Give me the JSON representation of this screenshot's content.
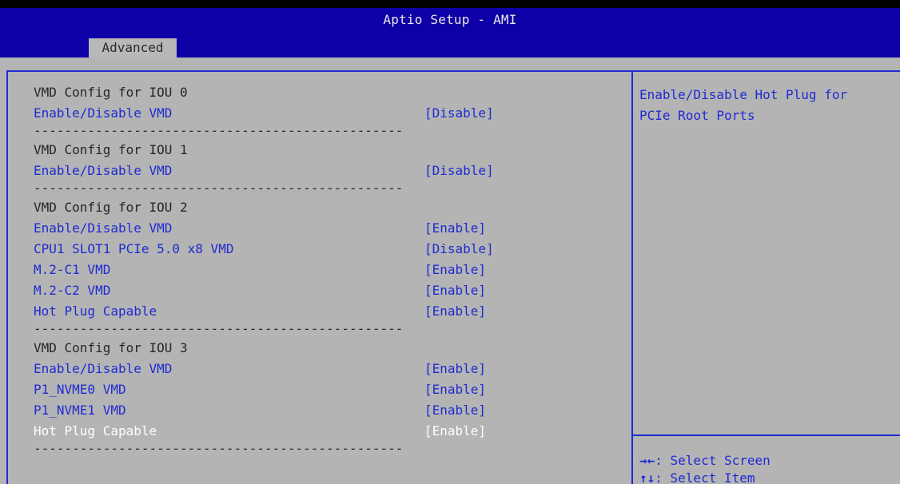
{
  "header": {
    "title": "Aptio Setup - AMI",
    "tab": "Advanced"
  },
  "separator": "------------------------------------------------",
  "sections": [
    {
      "heading": "VMD Config for IOU 0",
      "items": [
        {
          "label": "Enable/Disable VMD",
          "value": "[Disable]"
        }
      ]
    },
    {
      "heading": "VMD Config for IOU 1",
      "items": [
        {
          "label": "Enable/Disable VMD",
          "value": "[Disable]"
        }
      ]
    },
    {
      "heading": "VMD Config for IOU 2",
      "items": [
        {
          "label": "Enable/Disable VMD",
          "value": "[Enable]"
        },
        {
          "label": "CPU1 SLOT1 PCIe 5.0 x8 VMD",
          "value": "[Disable]"
        },
        {
          "label": "M.2-C1 VMD",
          "value": "[Enable]"
        },
        {
          "label": "M.2-C2 VMD",
          "value": "[Enable]"
        },
        {
          "label": "Hot Plug Capable",
          "value": "[Enable]"
        }
      ]
    },
    {
      "heading": "VMD Config for IOU 3",
      "items": [
        {
          "label": "Enable/Disable VMD",
          "value": "[Enable]"
        },
        {
          "label": "P1_NVME0 VMD",
          "value": "[Enable]"
        },
        {
          "label": "P1_NVME1 VMD",
          "value": "[Enable]"
        },
        {
          "label": "Hot Plug Capable",
          "value": "[Enable]",
          "selected": true
        }
      ]
    }
  ],
  "help": {
    "lines": [
      "Enable/Disable Hot Plug for",
      "PCIe Root Ports"
    ],
    "keys": [
      {
        "key": "→←",
        "action": ": Select Screen"
      },
      {
        "key": "↑↓",
        "action": ": Select Item"
      }
    ]
  },
  "colors": {
    "header_bg": "#0e00a6",
    "panel_bg": "#b4b4b4",
    "item_text": "#1f2bd1",
    "selected_text": "#ffffff",
    "heading_text": "#262626"
  }
}
